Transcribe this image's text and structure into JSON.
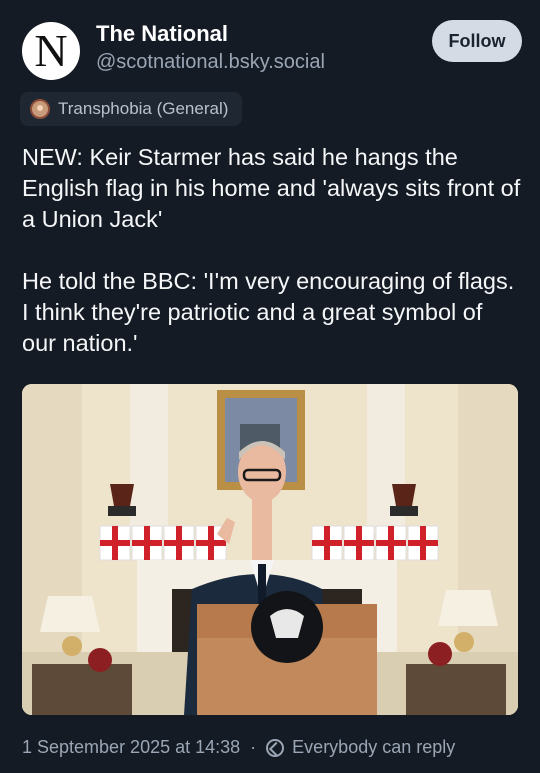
{
  "account": {
    "avatar_letter": "N",
    "name": "The National",
    "handle": "@scotnational.bsky.social",
    "follow_label": "Follow"
  },
  "label": {
    "text": "Transphobia (General)",
    "icon": "moderation-label-avatar-icon"
  },
  "post": {
    "text": "NEW: Keir Starmer has said he hangs the English flag in his home and 'always sits front of a Union Jack'\n\nHe told the BBC: 'I'm very encouraging of flags. I think they're patriotic and a great symbol of our nation.'"
  },
  "image": {
    "subject": "press-photo"
  },
  "footer": {
    "timestamp": "1 September 2025 at 14:38",
    "reply_setting": "Everybody can reply"
  },
  "colors": {
    "background": "#151b24",
    "text": "#f1f3f5",
    "muted": "#9aa6b5",
    "button": "#d4dbe4"
  }
}
